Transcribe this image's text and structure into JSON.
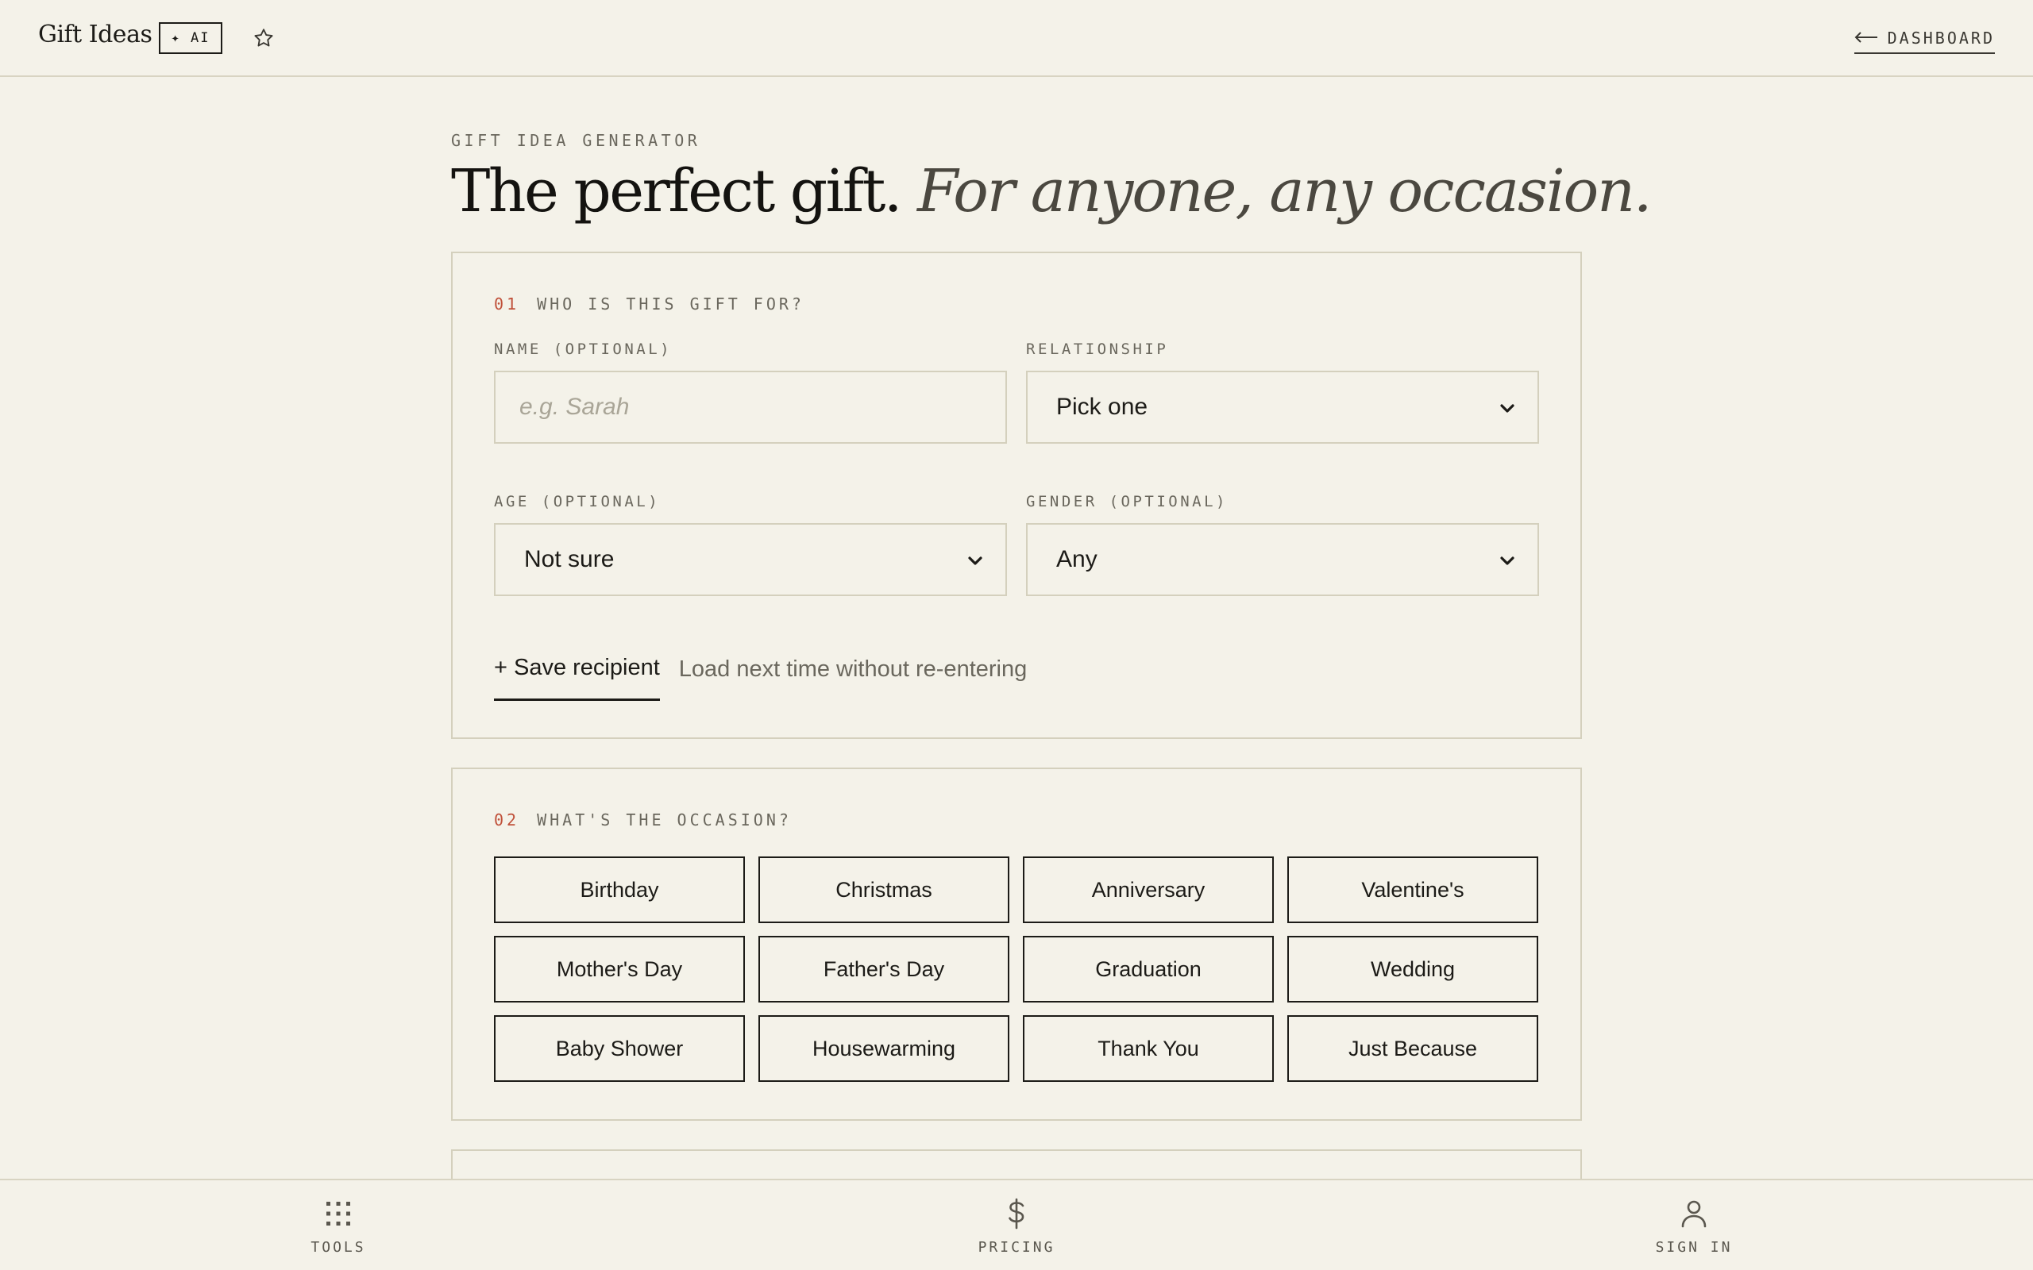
{
  "header": {
    "brand": "Gift Ideas",
    "ai_badge": "✦ AI",
    "star_icon": "star-outline",
    "dashboard_link": "DASHBOARD",
    "back_arrow_icon": "arrow-left"
  },
  "hero": {
    "eyebrow": "GIFT IDEA GENERATOR",
    "headline": "The perfect gift.",
    "headline_italic": "For anyone, any occasion."
  },
  "section1": {
    "number": "01",
    "title": "WHO IS THIS GIFT FOR?",
    "name_label": "NAME (OPTIONAL)",
    "name_placeholder": "e.g. Sarah",
    "relationship_label": "RELATIONSHIP",
    "relationship_value": "Pick one",
    "age_label": "AGE (OPTIONAL)",
    "age_value": "Not sure",
    "gender_label": "GENDER (OPTIONAL)",
    "gender_value": "Any",
    "save_button": "+ Save recipient",
    "save_hint": "Load next time without re-entering"
  },
  "section2": {
    "number": "02",
    "title": "WHAT'S THE OCCASION?",
    "occasions": [
      "Birthday",
      "Christmas",
      "Anniversary",
      "Valentine's",
      "Mother's Day",
      "Father's Day",
      "Graduation",
      "Wedding",
      "Baby Shower",
      "Housewarming",
      "Thank You",
      "Just Because"
    ]
  },
  "bottom_nav": {
    "tools": "TOOLS",
    "pricing": "PRICING",
    "sign_in": "SIGN IN"
  },
  "colors": {
    "background": "#f4f2e9",
    "text": "#1c1b17",
    "muted": "#6a675d",
    "accent": "#c0513a",
    "border": "#d4d0bd"
  }
}
